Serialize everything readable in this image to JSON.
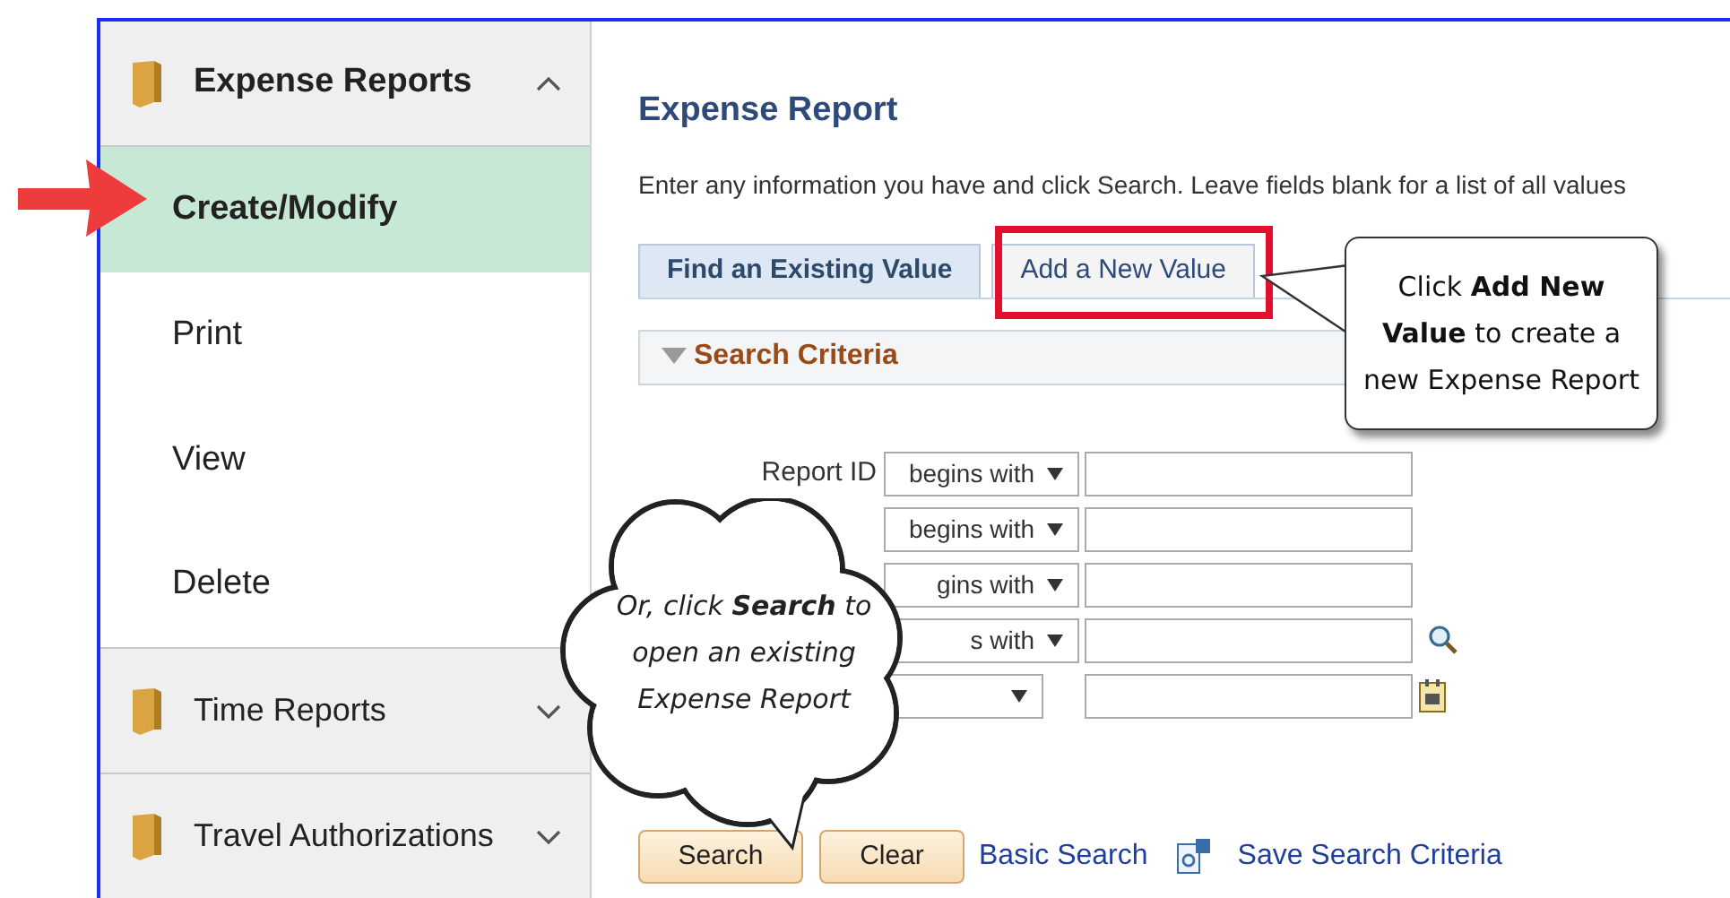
{
  "sidebar": {
    "sections": [
      {
        "label": "Expense Reports",
        "expanded": true,
        "items": [
          {
            "label": "Create/Modify",
            "selected": true
          },
          {
            "label": "Print",
            "selected": false
          },
          {
            "label": "View",
            "selected": false
          },
          {
            "label": "Delete",
            "selected": false
          }
        ]
      },
      {
        "label": "Time Reports",
        "expanded": false
      },
      {
        "label": "Travel Authorizations",
        "expanded": false
      }
    ]
  },
  "page": {
    "title": "Expense Report",
    "instructions": "Enter any information you have and click Search. Leave fields blank for a list of all values"
  },
  "tabs": [
    {
      "label": "Find an Existing Value",
      "selected": true
    },
    {
      "label": "Add a New Value",
      "selected": false
    }
  ],
  "search_criteria": {
    "heading": "Search Criteria",
    "expanded": true,
    "rows": [
      {
        "label": "Report ID",
        "operator": "begins with",
        "kind": "plain"
      },
      {
        "operator": "begins with",
        "kind": "plain"
      },
      {
        "operator": "gins with",
        "kind": "plain"
      },
      {
        "operator": "s with",
        "kind": "lookup"
      },
      {
        "kind": "date"
      }
    ]
  },
  "buttons": [
    "Search",
    "Clear"
  ],
  "links": [
    {
      "label": "Basic Search",
      "kind": "text"
    },
    {
      "label": "Save Search Criteria",
      "kind": "save"
    }
  ],
  "callouts": [
    {
      "kind": "box",
      "text": "Click **Add New Value** to create a new Expense Report"
    },
    {
      "kind": "cloud",
      "text": "Or, click **Search** to open an existing Expense Report"
    }
  ]
}
